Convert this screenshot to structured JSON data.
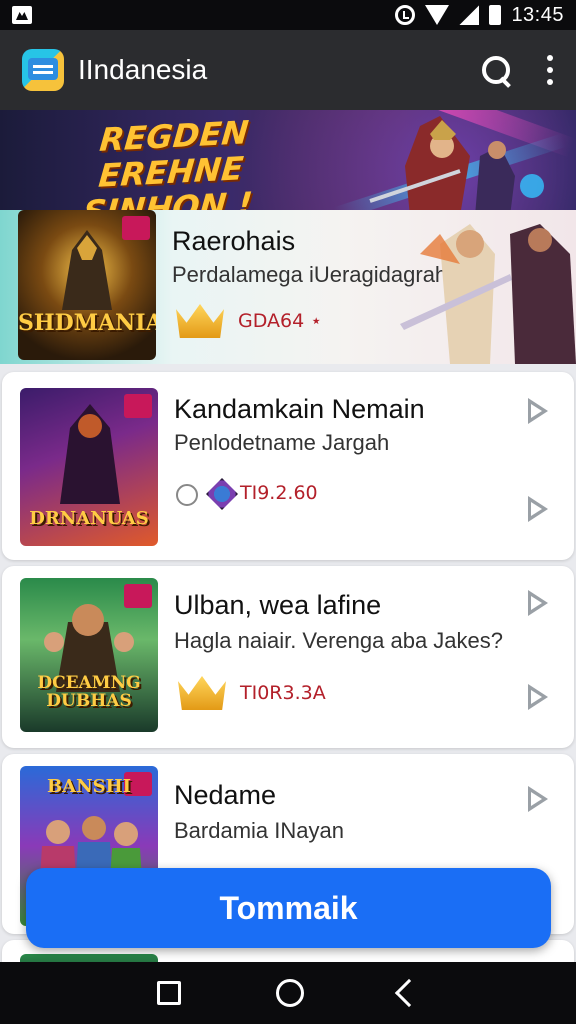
{
  "status_bar": {
    "time": "13:45"
  },
  "app_bar": {
    "title": "IIndanesia"
  },
  "banner": {
    "title": "REGDEN EREHNE SINHON !"
  },
  "items": [
    {
      "title": "Raerohais",
      "subtitle": "Perdalamega iUeragidagrah",
      "metric": "GDA64 ⋆",
      "thumb_label": "SHDMANIA"
    },
    {
      "title": "Kandamkain Nemain",
      "subtitle": "Penlodetname Jargah",
      "metric": "TI9.2.60",
      "thumb_label": "DRNANUAS"
    },
    {
      "title": "Ulban, wea lafine",
      "subtitle": "Hagla naiair. Verenga aba Jakes?",
      "metric": "TI0R3.3A",
      "thumb_label": "DCEAMNG DUBHAS"
    },
    {
      "title": "Nedame",
      "subtitle": "Bardamia INayan",
      "metric": "",
      "thumb_label": "BANSHI"
    }
  ],
  "cta": {
    "label": "Tommaik"
  },
  "colors": {
    "accent": "#1a6ef5",
    "appbar": "#2b2c2f",
    "metric": "#b3202a"
  }
}
